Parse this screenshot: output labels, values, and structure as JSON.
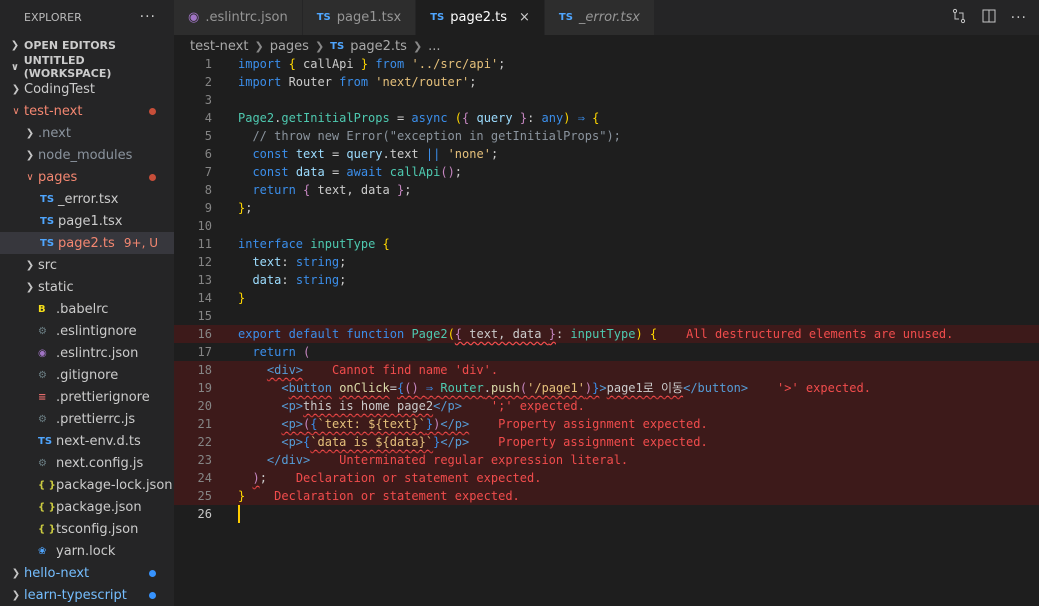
{
  "explorer": {
    "title": "EXPLORER",
    "more": "···",
    "open_editors": "OPEN EDITORS",
    "workspace": "UNTITLED (WORKSPACE)"
  },
  "tree": [
    {
      "label": "CodingTest",
      "indent": 0,
      "kind": "folder",
      "open": false,
      "style": "normal"
    },
    {
      "label": "test-next",
      "indent": 0,
      "kind": "folder",
      "open": true,
      "style": "err",
      "dot": "#c74e39"
    },
    {
      "label": ".next",
      "indent": 1,
      "kind": "folder",
      "open": false,
      "style": "muted"
    },
    {
      "label": "node_modules",
      "indent": 1,
      "kind": "folder",
      "open": false,
      "style": "muted"
    },
    {
      "label": "pages",
      "indent": 1,
      "kind": "folder",
      "open": true,
      "style": "err",
      "dot": "#c74e39"
    },
    {
      "label": "_error.tsx",
      "indent": 2,
      "kind": "ts",
      "style": "normal"
    },
    {
      "label": "page1.tsx",
      "indent": 2,
      "kind": "ts",
      "style": "normal"
    },
    {
      "label": "page2.ts",
      "indent": 2,
      "kind": "ts",
      "style": "err",
      "selected": true,
      "badge": "9+, U"
    },
    {
      "label": "src",
      "indent": 1,
      "kind": "folder",
      "open": false,
      "style": "normal"
    },
    {
      "label": "static",
      "indent": 1,
      "kind": "folder",
      "open": false,
      "style": "normal"
    },
    {
      "label": ".babelrc",
      "indent": 1,
      "kind": "babel",
      "style": "normal"
    },
    {
      "label": ".eslintignore",
      "indent": 1,
      "kind": "gear",
      "style": "normal"
    },
    {
      "label": ".eslintrc.json",
      "indent": 1,
      "kind": "eslint",
      "style": "normal"
    },
    {
      "label": ".gitignore",
      "indent": 1,
      "kind": "gear",
      "style": "normal"
    },
    {
      "label": ".prettierignore",
      "indent": 1,
      "kind": "prettier",
      "style": "normal"
    },
    {
      "label": ".prettierrc.js",
      "indent": 1,
      "kind": "gear",
      "style": "normal"
    },
    {
      "label": "next-env.d.ts",
      "indent": 1,
      "kind": "ts",
      "style": "normal"
    },
    {
      "label": "next.config.js",
      "indent": 1,
      "kind": "gear",
      "style": "normal"
    },
    {
      "label": "package-lock.json",
      "indent": 1,
      "kind": "json",
      "style": "normal"
    },
    {
      "label": "package.json",
      "indent": 1,
      "kind": "json",
      "style": "normal"
    },
    {
      "label": "tsconfig.json",
      "indent": 1,
      "kind": "json",
      "style": "normal"
    },
    {
      "label": "yarn.lock",
      "indent": 1,
      "kind": "yarn",
      "style": "normal"
    },
    {
      "label": "hello-next",
      "indent": 0,
      "kind": "folder",
      "open": false,
      "style": "blue",
      "dot": "#3794ff"
    },
    {
      "label": "learn-typescript",
      "indent": 0,
      "kind": "folder",
      "open": false,
      "style": "blue",
      "dot": "#3794ff"
    }
  ],
  "tabs": [
    {
      "label": ".eslintrc.json",
      "icon": "eslint",
      "active": false,
      "italic": false
    },
    {
      "label": "page1.tsx",
      "icon": "TS",
      "active": false,
      "italic": false
    },
    {
      "label": "page2.ts",
      "icon": "TS",
      "active": true,
      "italic": false
    },
    {
      "label": "_error.tsx",
      "icon": "TS",
      "active": false,
      "italic": true
    }
  ],
  "tab_close": "×",
  "breadcrumb": {
    "parts": [
      "test-next",
      "pages",
      "page2.ts",
      "..."
    ],
    "file_icon": "TS"
  },
  "code": {
    "lines": [
      "1",
      "2",
      "3",
      "4",
      "5",
      "6",
      "7",
      "8",
      "9",
      "10",
      "11",
      "12",
      "13",
      "14",
      "15",
      "16",
      "17",
      "18",
      "19",
      "20",
      "21",
      "22",
      "23",
      "24",
      "25",
      "26"
    ],
    "diagnostics": {
      "16": "All destructured elements are unused.",
      "18": "Cannot find name 'div'.",
      "19": "'>' expected.",
      "20": "';' expected.",
      "21": "Property assignment expected.",
      "22": "Property assignment expected.",
      "23": "Unterminated regular expression literal.",
      "24": "Declaration or statement expected.",
      "25": "Declaration or statement expected."
    }
  }
}
